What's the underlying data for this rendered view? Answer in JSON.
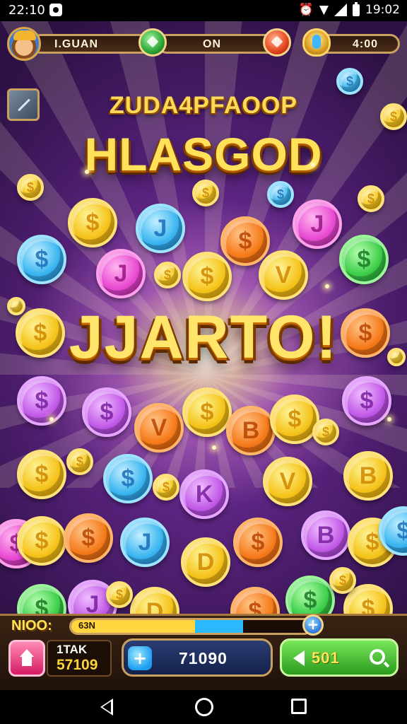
{
  "status_bar": {
    "time_left": "22:10",
    "time_right": "19:02",
    "icons": [
      "notification-icon",
      "alarm-icon",
      "wifi-icon",
      "signal-icon",
      "battery-icon"
    ]
  },
  "hud_top": {
    "player_label": "I.GUAN",
    "middle_label": "ON",
    "right_value": "4:00"
  },
  "banner": {
    "subtitle": "ZUDA4PFAOOP",
    "title": "HLASGOD",
    "jackpot": "JJARTO!"
  },
  "coin_symbols": [
    "$",
    "J",
    "V",
    "K",
    "B",
    "D"
  ],
  "hud_bottom": {
    "label": "NIOO:",
    "progress_text": "63N",
    "progress_fraction": 0.72,
    "stat_line1": "1TAK",
    "stat_line2": "57109",
    "pill_value": "71090",
    "green_button_value": "501"
  },
  "colors": {
    "gold": "#f5c31a",
    "bg_purple": "#5a237f",
    "accent_green": "#2a9a1e",
    "accent_blue": "#2b77d8"
  }
}
